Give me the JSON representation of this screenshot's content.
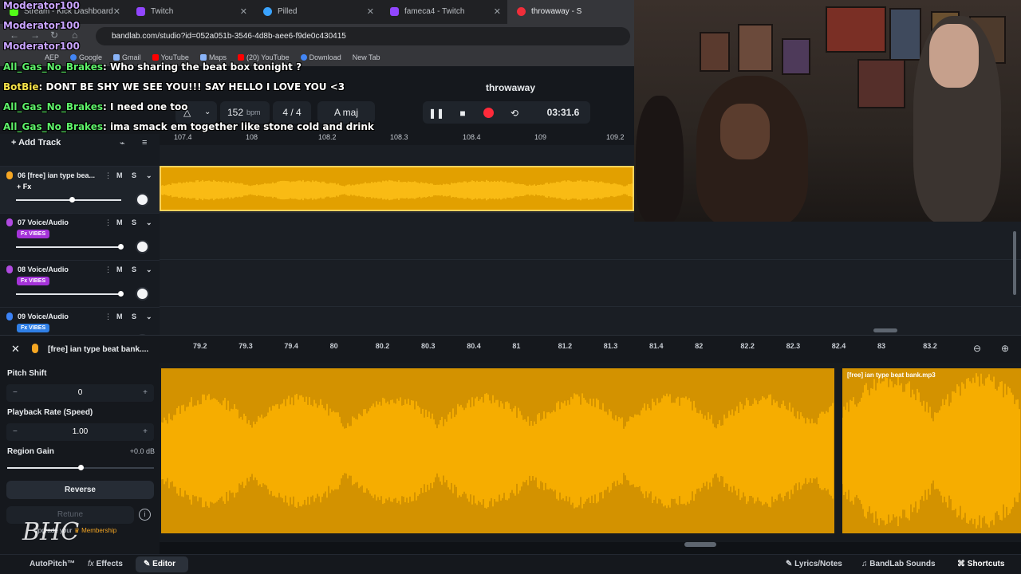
{
  "browser": {
    "tabs": [
      {
        "title": "Stream - Kick Dashboard",
        "icon": "kick"
      },
      {
        "title": "Twitch",
        "icon": "twitch"
      },
      {
        "title": "Pilled",
        "icon": "pilled"
      },
      {
        "title": "fameca4 - Twitch",
        "icon": "twitch"
      },
      {
        "title": "throwaway - S",
        "icon": "bandlab"
      }
    ],
    "url": "bandlab.com/studio?id=052a051b-3546-4d8b-aee6-f9de0c430415",
    "bookmarks": [
      "AEP",
      "Google",
      "Gmail",
      "YouTube",
      "Maps",
      "(20) YouTube",
      "Download",
      "New Tab"
    ]
  },
  "studio": {
    "project_title": "throwaway",
    "bpm_value": "152",
    "bpm_unit": "bpm",
    "time_signature": "4 / 4",
    "key": "A maj",
    "time": "03:31.6",
    "add_track_label": "Add Track",
    "ruler_top": [
      "107.4",
      "108",
      "108.2",
      "108.3",
      "108.4",
      "109",
      "109.2"
    ],
    "tracks": [
      {
        "number": "06",
        "name": "[free] ian type bea...",
        "fx": "+ Fx",
        "fx_style": "plain",
        "vol_fraction": 0.52,
        "color": "#f5a623"
      },
      {
        "number": "07",
        "name": "Voice/Audio",
        "fx": "Fx VIBES",
        "fx_style": "purple",
        "vol_fraction": 1.0,
        "color": "#b04ae0"
      },
      {
        "number": "08",
        "name": "Voice/Audio",
        "fx": "Fx VIBES",
        "fx_style": "purple",
        "vol_fraction": 1.0,
        "color": "#b04ae0"
      },
      {
        "number": "09",
        "name": "Voice/Audio",
        "fx": "Fx VIBES",
        "fx_style": "blue",
        "vol_fraction": 1.0,
        "color": "#3b82f6"
      }
    ],
    "mute_label": "M",
    "solo_label": "S"
  },
  "editor": {
    "region_title": "[free] ian type beat bank....",
    "ruler": [
      "79.2",
      "79.3",
      "79.4",
      "80",
      "80.2",
      "80.3",
      "80.4",
      "81",
      "81.2",
      "81.3",
      "81.4",
      "82",
      "82.2",
      "82.3",
      "82.4",
      "83",
      "83.2"
    ],
    "pitch_shift_label": "Pitch Shift",
    "pitch_shift_value": "0",
    "playback_rate_label": "Playback Rate (Speed)",
    "playback_rate_value": "1.00",
    "region_gain_label": "Region Gain",
    "region_gain_value": "+0.0 dB",
    "region_gain_fraction": 0.5,
    "reverse_label": "Reverse",
    "retune_label": "Retune",
    "membership_text": "Upgrade your",
    "membership_label": "Membership",
    "second_clip_label": "[free] ian type beat bank.mp3"
  },
  "bottom_bar": {
    "autopitch": "AutoPitch™",
    "effects": "Effects",
    "editor": "Editor",
    "lyrics": "Lyrics/Notes",
    "sounds": "BandLab Sounds",
    "shortcuts": "Shortcuts"
  },
  "chat": [
    {
      "user": "Moderator100",
      "message": "",
      "color": "purple"
    },
    {
      "user": "Moderator100",
      "message": "",
      "color": "purple"
    },
    {
      "user": "Moderator100",
      "message": "",
      "color": "purple"
    },
    {
      "user": "All_Gas_No_Brakes",
      "message": ": Who sharing the beat box tonight ?",
      "color": "green"
    },
    {
      "user": "BotBie",
      "message": ": DONT BE SHY WE SEE YOU!!! SAY HELLO I LOVE YOU <3",
      "color": "yellow"
    },
    {
      "user": "All_Gas_No_Brakes",
      "message": ": I need one too",
      "color": "green"
    },
    {
      "user": "All_Gas_No_Brakes",
      "message": ": ima smack em together like stone cold and drink",
      "color": "green"
    }
  ],
  "colors": {
    "accent": "#f5a623",
    "clip": "#e2a000",
    "record": "#ff2a3a",
    "fx_purple": "#a533d9",
    "fx_blue": "#2f7fe6"
  }
}
